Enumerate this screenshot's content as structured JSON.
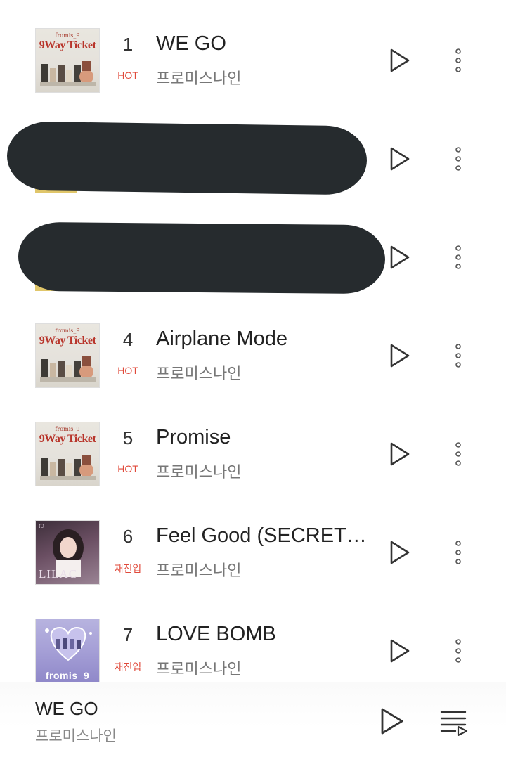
{
  "tracks": [
    {
      "rank": "1",
      "badge": "HOT",
      "title": "WE GO",
      "artist": "프로미스나인",
      "album_art_text": "fromis_9 9Way Ticket",
      "play_icon": "play-outline-icon",
      "more_icon": "vertical-dots-icon"
    },
    {
      "rank": "",
      "badge": "",
      "title": "",
      "artist": "",
      "redacted": true,
      "play_icon": "play-outline-icon",
      "more_icon": "vertical-dots-icon"
    },
    {
      "rank": "",
      "badge": "",
      "title": "",
      "artist": "",
      "redacted": true,
      "play_icon": "play-outline-icon",
      "more_icon": "vertical-dots-icon"
    },
    {
      "rank": "4",
      "badge": "HOT",
      "title": "Airplane Mode",
      "artist": "프로미스나인",
      "album_art_text": "fromis_9 9Way Ticket",
      "play_icon": "play-outline-icon",
      "more_icon": "vertical-dots-icon"
    },
    {
      "rank": "5",
      "badge": "HOT",
      "title": "Promise",
      "artist": "프로미스나인",
      "album_art_text": "fromis_9 9Way Ticket",
      "play_icon": "play-outline-icon",
      "more_icon": "vertical-dots-icon"
    },
    {
      "rank": "6",
      "badge": "재진입",
      "title": "Feel Good (SECRET…",
      "artist": "프로미스나인",
      "album_art_text": "LILAC",
      "play_icon": "play-outline-icon",
      "more_icon": "vertical-dots-icon"
    },
    {
      "rank": "7",
      "badge": "재진입",
      "title": "LOVE BOMB",
      "artist": "프로미스나인",
      "album_art_text": "fromis_9",
      "play_icon": "play-outline-icon",
      "more_icon": "vertical-dots-icon"
    }
  ],
  "album_art": {
    "nineway_brand": "fromis_9",
    "nineway_title": "9Way Ticket",
    "lilac_brand": "IU",
    "lilac_title": "LILAC",
    "fromis_title": "fromis_9"
  },
  "mini_player": {
    "title": "WE GO",
    "artist": "프로미스나인",
    "play_icon": "play-outline-icon",
    "playlist_icon": "playlist-icon"
  },
  "colors": {
    "badge": "#e0493a",
    "text_primary": "#222222",
    "text_secondary": "#777777",
    "redaction": "#262b2e"
  }
}
